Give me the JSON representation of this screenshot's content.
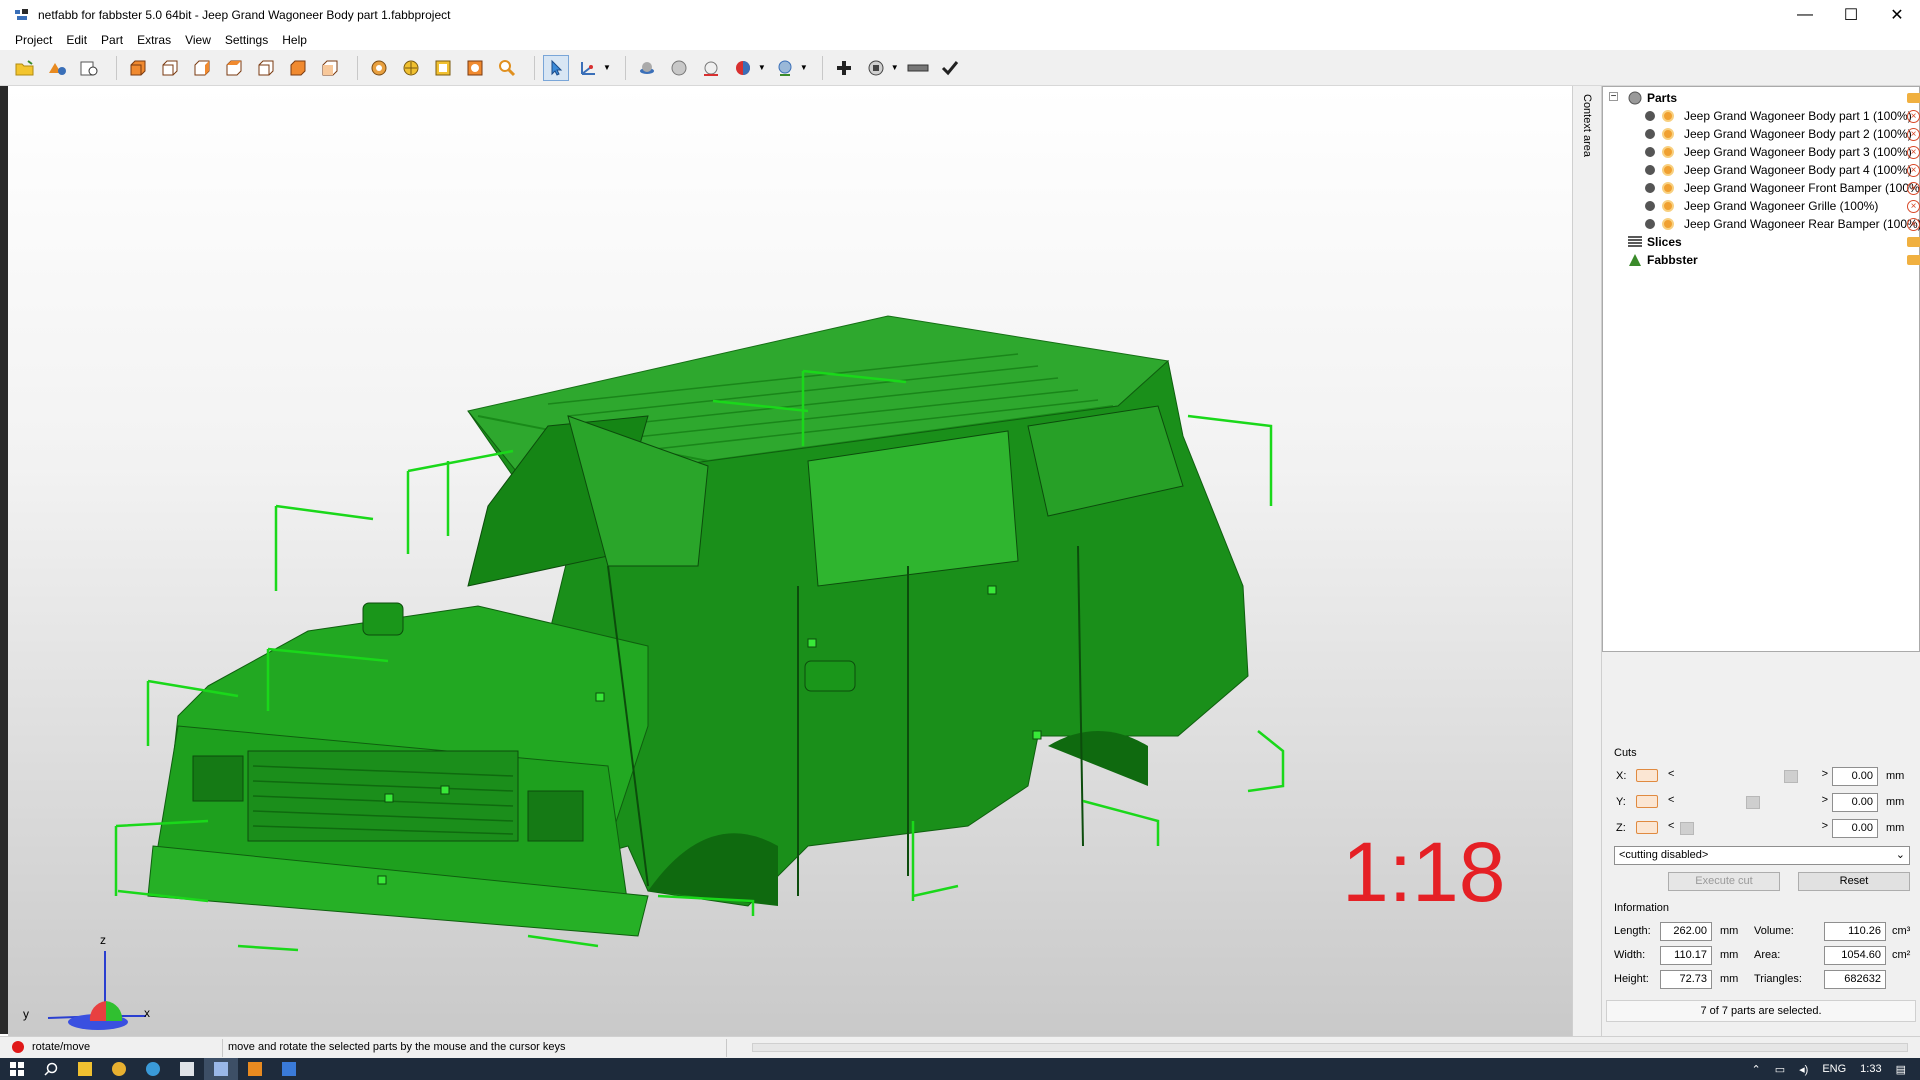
{
  "window": {
    "title": "netfabb for fabbster 5.0 64bit - Jeep Grand Wagoneer Body part 1.fabbproject",
    "minimize_glyph": "—",
    "maximize_glyph": "☐",
    "close_glyph": "✕"
  },
  "menu": {
    "items": [
      "Project",
      "Edit",
      "Part",
      "Extras",
      "View",
      "Settings",
      "Help"
    ]
  },
  "toolbar": {
    "icons": [
      "open-project-icon",
      "add-part-icon",
      "settings-icon",
      "view-front-icon",
      "view-back-icon",
      "view-left-icon",
      "view-right-icon",
      "view-top-icon",
      "view-bottom-icon",
      "view-perspective-icon",
      "rotate-icon",
      "pan-icon",
      "zoom-window-icon",
      "zoom-fit-icon",
      "zoom-icon",
      "select-pointer-icon",
      "measure-axis-icon",
      "render-solid-icon",
      "render-sphere-icon",
      "render-wire-icon",
      "render-color-icon",
      "shading-icon",
      "add-icon",
      "repair-icon",
      "ruler-icon",
      "checkmark-icon"
    ]
  },
  "viewport": {
    "model_color": "#1fb41f",
    "ratio_label": "1:18",
    "axis": {
      "z": "z",
      "y": "y",
      "x": "x"
    }
  },
  "context_area": {
    "label": "Context area"
  },
  "tree": {
    "root": "Parts",
    "parts": [
      "Jeep Grand Wagoneer Body part 1 (100%)",
      "Jeep Grand Wagoneer Body part 2 (100%)",
      "Jeep Grand Wagoneer Body part 3 (100%)",
      "Jeep Grand Wagoneer Body part 4 (100%)",
      "Jeep Grand Wagoneer Front Bamper (100%)",
      "Jeep Grand Wagoneer Grille (100%)",
      "Jeep Grand Wagoneer Rear Bamper (100%)"
    ],
    "slices": "Slices",
    "fabbster": "Fabbster"
  },
  "cuts": {
    "title": "Cuts",
    "x_label": "X:",
    "y_label": "Y:",
    "z_label": "Z:",
    "x_value": "0.00",
    "y_value": "0.00",
    "z_value": "0.00",
    "unit": "mm",
    "lt": "<",
    "gt": ">",
    "mode": "<cutting disabled>",
    "execute": "Execute cut",
    "reset": "Reset"
  },
  "information": {
    "title": "Information",
    "length_label": "Length:",
    "length": "262.00",
    "width_label": "Width:",
    "width": "110.17",
    "height_label": "Height:",
    "height": "72.73",
    "unit": "mm",
    "volume_label": "Volume:",
    "volume": "110.26",
    "volume_unit": "cm³",
    "area_label": "Area:",
    "area": "1054.60",
    "area_unit": "cm²",
    "triangles_label": "Triangles:",
    "triangles": "682632",
    "selection": "7 of 7 parts are selected."
  },
  "status": {
    "mode": "rotate/move",
    "message": "move and rotate the selected parts by the mouse and the cursor keys"
  },
  "taskbar": {
    "lang": "ENG",
    "time": "1:33"
  }
}
